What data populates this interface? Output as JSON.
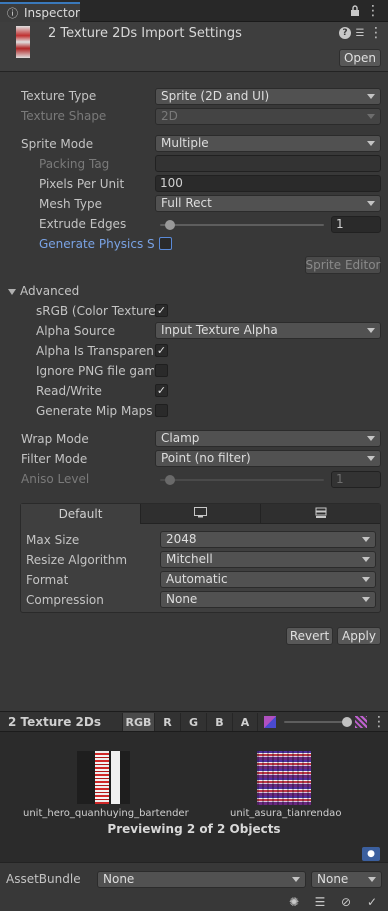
{
  "window": {
    "tab_title": "Inspector"
  },
  "header": {
    "title": "2 Texture 2Ds Import Settings",
    "open_button": "Open"
  },
  "texture": {
    "type_label": "Texture Type",
    "type_value": "Sprite (2D and UI)",
    "shape_label": "Texture Shape",
    "shape_value": "2D",
    "sprite_mode_label": "Sprite Mode",
    "sprite_mode_value": "Multiple",
    "packing_tag_label": "Packing Tag",
    "packing_tag_value": "",
    "ppu_label": "Pixels Per Unit",
    "ppu_value": "100",
    "mesh_type_label": "Mesh Type",
    "mesh_type_value": "Full Rect",
    "extrude_label": "Extrude Edges",
    "extrude_value": "1",
    "extrude_fraction": 0.0625,
    "physics_label": "Generate Physics Sh",
    "physics_checked": false,
    "sprite_editor_button": "Sprite Editor"
  },
  "advanced": {
    "header": "Advanced",
    "srgb_label": "sRGB (Color Texture)",
    "srgb_checked": true,
    "alpha_source_label": "Alpha Source",
    "alpha_source_value": "Input Texture Alpha",
    "alpha_transparency_label": "Alpha Is Transparenc",
    "alpha_transparency_checked": true,
    "ignore_png_label": "Ignore PNG file gamn",
    "ignore_png_checked": false,
    "read_write_label": "Read/Write",
    "read_write_checked": true,
    "mipmaps_label": "Generate Mip Maps",
    "mipmaps_checked": false
  },
  "sampling": {
    "wrap_label": "Wrap Mode",
    "wrap_value": "Clamp",
    "filter_label": "Filter Mode",
    "filter_value": "Point (no filter)",
    "aniso_label": "Aniso Level",
    "aniso_value": "1",
    "aniso_fraction": 0.0625
  },
  "platform": {
    "tabs": [
      "Default",
      "monitor-icon",
      "build-target-icon"
    ],
    "max_size_label": "Max Size",
    "max_size_value": "2048",
    "resize_label": "Resize Algorithm",
    "resize_value": "Mitchell",
    "format_label": "Format",
    "format_value": "Automatic",
    "compression_label": "Compression",
    "compression_value": "None"
  },
  "actions": {
    "revert": "Revert",
    "apply": "Apply"
  },
  "preview": {
    "title": "2 Texture 2Ds",
    "channels": [
      "RGB",
      "R",
      "G",
      "B",
      "A"
    ],
    "mip_fraction": 0.95,
    "items": [
      {
        "name": "unit_hero_quanhuying_bartender"
      },
      {
        "name": "unit_asura_tianrendao"
      }
    ],
    "status": "Previewing 2 of 2 Objects"
  },
  "assetbundle": {
    "label": "AssetBundle",
    "name_value": "None",
    "variant_value": "None"
  },
  "colors": {
    "accent": "#3a79bb",
    "link": "#7aa3e5"
  }
}
